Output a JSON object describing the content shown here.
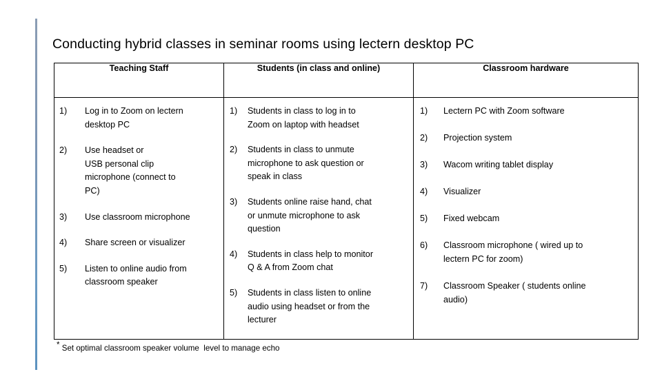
{
  "slide": {
    "title": "Conducting hybrid classes in seminar rooms using lectern desktop PC",
    "footnote_marker": "*",
    "footnote_text": " Set optimal classroom speaker volume  level to manage echo",
    "accent_color": "#7e96b4"
  },
  "table": {
    "headers": [
      "Teaching Staff",
      "Students (in class and online)",
      "Classroom hardware"
    ],
    "columns": [
      {
        "name": "teaching-staff",
        "items": [
          {
            "marker": "1)",
            "text": "Log in to Zoom on lectern\ndesktop PC"
          },
          {
            "marker": "2)",
            "text": "Use headset  or\nUSB personal clip\nmicrophone (connect to\nPC)"
          },
          {
            "marker": "3)",
            "text": "Use classroom microphone"
          },
          {
            "marker": "4)",
            "text": "Share screen or visualizer"
          },
          {
            "marker": "5)",
            "text": "Listen to online audio from\nclassroom speaker"
          }
        ]
      },
      {
        "name": "students",
        "items": [
          {
            "marker": "1)",
            "text": "Students in class to log in to\nZoom  on laptop with headset"
          },
          {
            "marker": "2)",
            "text": "Students in class to unmute\nmicrophone to ask question or\nspeak in class"
          },
          {
            "marker": "3)",
            "text": "Students online raise hand, chat\nor unmute microphone to ask\nquestion"
          },
          {
            "marker": "4)",
            "text": "Students in class help to monitor\nQ & A from Zoom chat"
          },
          {
            "marker": "5)",
            "text": "Students in class listen to online\naudio using headset or from the\nlecturer"
          }
        ]
      },
      {
        "name": "classroom-hardware",
        "items": [
          {
            "marker": "1)",
            "text": "Lectern PC with Zoom software"
          },
          {
            "marker": "2)",
            "text": "Projection system"
          },
          {
            "marker": "3)",
            "text": "Wacom writing tablet display"
          },
          {
            "marker": "4)",
            "text": "Visualizer"
          },
          {
            "marker": "5)",
            "text": "Fixed webcam"
          },
          {
            "marker": "6)",
            "text": "Classroom microphone ( wired up to\nlectern PC for zoom)"
          },
          {
            "marker": "7)",
            "text": "Classroom Speaker ( students online\naudio)"
          }
        ]
      }
    ]
  }
}
